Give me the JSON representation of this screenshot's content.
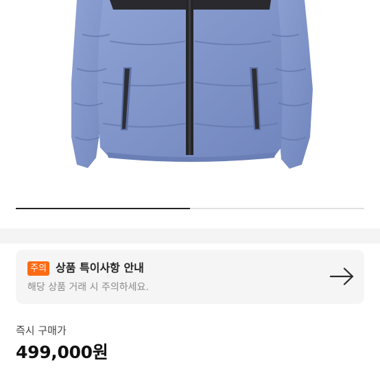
{
  "product": {
    "image_alt": "blue puffer down jacket"
  },
  "carousel": {
    "progress": 0.5
  },
  "notice": {
    "badge": "주의",
    "title": "상품 특이사항 안내",
    "subtitle": "해당 상품 거래 시 주의하세요.",
    "arrow_icon": "arrow-right-icon"
  },
  "price": {
    "label": "즉시 구매가",
    "value": "499,000원"
  },
  "colors": {
    "jacket": "#7f95c9",
    "badge": "#ff6a13",
    "card_bg": "#f5f5f5"
  }
}
